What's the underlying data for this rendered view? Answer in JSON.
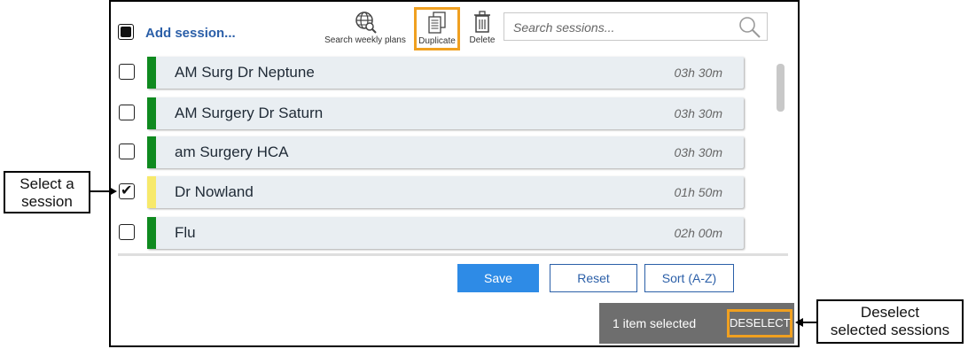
{
  "header": {
    "add_session_label": "Add session...",
    "tools": {
      "search_weekly_plans": "Search weekly plans",
      "duplicate": "Duplicate",
      "delete": "Delete"
    },
    "search": {
      "placeholder": "Search sessions..."
    }
  },
  "sessions": [
    {
      "name": "AM Surg Dr Neptune",
      "duration": "03h 30m",
      "color": "#0f8a1f",
      "checked": false
    },
    {
      "name": "AM Surgery Dr Saturn",
      "duration": "03h 30m",
      "color": "#0f8a1f",
      "checked": false
    },
    {
      "name": "am Surgery HCA",
      "duration": "03h 30m",
      "color": "#0f8a1f",
      "checked": false
    },
    {
      "name": "Dr Nowland",
      "duration": "01h 50m",
      "color": "#f7e96b",
      "checked": true
    },
    {
      "name": "Flu",
      "duration": "02h 00m",
      "color": "#0f8a1f",
      "checked": false
    }
  ],
  "buttons": {
    "save": "Save",
    "reset": "Reset",
    "sort": "Sort (A-Z)"
  },
  "selection": {
    "text": "1 item selected",
    "deselect": "DESELECT"
  },
  "callouts": {
    "select_line1": "Select a",
    "select_line2": "session",
    "deselect_line1": "Deselect",
    "deselect_line2": "selected sessions"
  },
  "colors": {
    "accent": "#2e8be6",
    "highlight": "#f0a020",
    "link": "#2b5fa8"
  }
}
